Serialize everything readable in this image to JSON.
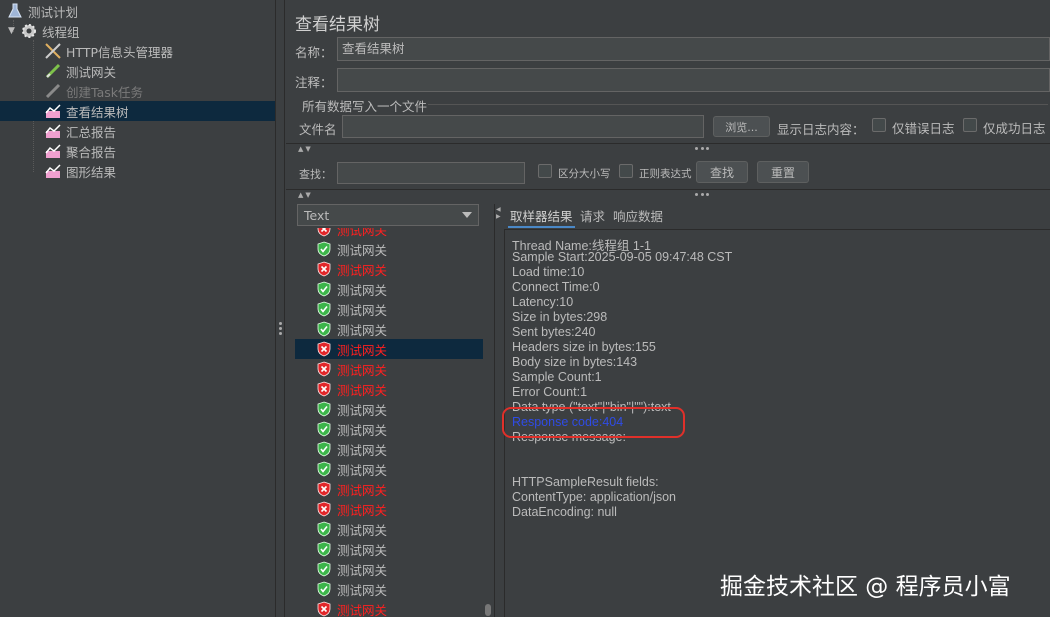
{
  "tree": {
    "items": [
      {
        "label": "测试计划",
        "icon": "flask-icon"
      },
      {
        "label": "线程组",
        "icon": "gear-icon"
      },
      {
        "label": "HTTP信息头管理器",
        "icon": "tools-icon"
      },
      {
        "label": "测试网关",
        "icon": "pipette-icon"
      },
      {
        "label": "创建Task任务",
        "icon": "pipette-icon",
        "disabled": true
      },
      {
        "label": "查看结果树",
        "icon": "listener-chart-icon",
        "selected": true
      },
      {
        "label": "汇总报告",
        "icon": "listener-chart-icon"
      },
      {
        "label": "聚合报告",
        "icon": "listener-chart-icon"
      },
      {
        "label": "图形结果",
        "icon": "listener-chart-icon"
      }
    ]
  },
  "panel": {
    "title": "查看结果树",
    "name_label": "名称：",
    "name_value": "查看结果树",
    "comment_label": "注释：",
    "comment_value": "",
    "group_title": "所有数据写入一个文件",
    "filename_label": "文件名",
    "filename_value": "",
    "browse_button": "浏览...",
    "log_content_label": "显示日志内容：",
    "errors_only_label": "仅错误日志",
    "success_only_label": "仅成功日志"
  },
  "search": {
    "label": "查找：",
    "value": "",
    "case_sensitive_label": "区分大小写",
    "regex_label": "正则表达式",
    "find_button": "查找",
    "reset_button": "重置"
  },
  "results": {
    "renderer_selected": "Text",
    "rows": [
      {
        "label": "测试网关",
        "status": "error"
      },
      {
        "label": "测试网关",
        "status": "ok"
      },
      {
        "label": "测试网关",
        "status": "error"
      },
      {
        "label": "测试网关",
        "status": "ok"
      },
      {
        "label": "测试网关",
        "status": "ok"
      },
      {
        "label": "测试网关",
        "status": "ok"
      },
      {
        "label": "测试网关",
        "status": "error",
        "selected": true
      },
      {
        "label": "测试网关",
        "status": "error"
      },
      {
        "label": "测试网关",
        "status": "error"
      },
      {
        "label": "测试网关",
        "status": "ok"
      },
      {
        "label": "测试网关",
        "status": "ok"
      },
      {
        "label": "测试网关",
        "status": "ok"
      },
      {
        "label": "测试网关",
        "status": "ok"
      },
      {
        "label": "测试网关",
        "status": "error"
      },
      {
        "label": "测试网关",
        "status": "error"
      },
      {
        "label": "测试网关",
        "status": "ok"
      },
      {
        "label": "测试网关",
        "status": "ok"
      },
      {
        "label": "测试网关",
        "status": "ok"
      },
      {
        "label": "测试网关",
        "status": "ok"
      },
      {
        "label": "测试网关",
        "status": "error"
      }
    ]
  },
  "tabs": [
    "取样器结果",
    "请求",
    "响应数据"
  ],
  "detail": {
    "lines": [
      "Thread Name:线程组 1-1",
      "Sample Start:2025-09-05 09:47:48 CST",
      "Load time:10",
      "Connect Time:0",
      "Latency:10",
      "Size in bytes:298",
      "Sent bytes:240",
      "Headers size in bytes:155",
      "Body size in bytes:143",
      "Sample Count:1",
      "Error Count:1",
      "Data type (\"text\"|\"bin\"|\"\"):text",
      "Response code:404",
      "Response message:",
      "",
      "",
      "HTTPSampleResult fields:",
      "ContentType: application/json",
      "DataEncoding: null"
    ]
  },
  "colors": {
    "error_text": "#ff2020",
    "selection": "#0d293e",
    "response_code": "#2f4ce6",
    "highlight_box": "#e0302a"
  },
  "watermark": "掘金技术社区 @ 程序员小富"
}
